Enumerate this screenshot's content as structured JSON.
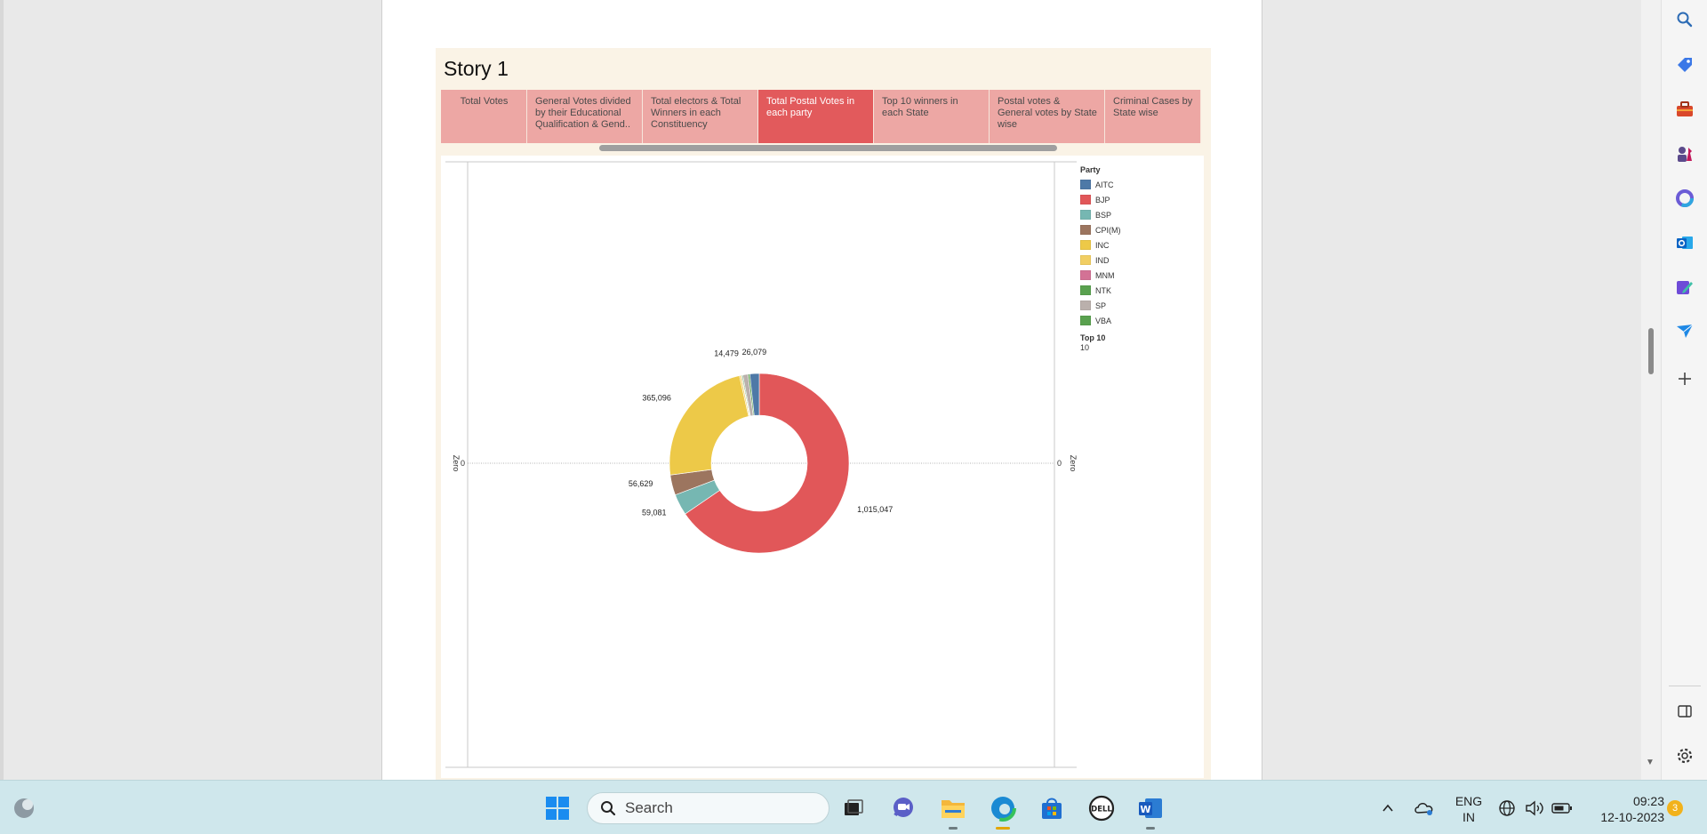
{
  "story": {
    "title": "Story 1",
    "tabs": [
      {
        "label": "Total Votes",
        "width": 97,
        "active": false,
        "centered": true
      },
      {
        "label": "General Votes divided by their Educational Qualification & Gend..",
        "width": 130,
        "active": false
      },
      {
        "label": "Total electors & Total Winners in each Constituency",
        "width": 130,
        "active": false
      },
      {
        "label": "Total Postal Votes in each party",
        "width": 130,
        "active": true
      },
      {
        "label": "Top 10 winners in each State",
        "width": 130,
        "active": false
      },
      {
        "label": "Postal votes & General votes by State wise",
        "width": 130,
        "active": false
      },
      {
        "label": "Criminal Cases by State wise",
        "width": 108,
        "active": false
      }
    ]
  },
  "chart_data": {
    "type": "pie",
    "donut": true,
    "title": "",
    "legend_title": "Party",
    "legend_position": "right",
    "slices": [
      {
        "label": "BJP",
        "value": 1015047,
        "color": "#e15759",
        "data_label": "1,015,047"
      },
      {
        "label": "BSP",
        "value": 59081,
        "color": "#76b7b2",
        "data_label": "59,081"
      },
      {
        "label": "CPI(M)",
        "value": 56629,
        "color": "#9c755f",
        "data_label": "56,629"
      },
      {
        "label": "INC",
        "value": 365096,
        "color": "#edc948",
        "data_label": "365,096"
      },
      {
        "label": "IND",
        "value": 4500,
        "color": "#f1ce63",
        "data_label": ""
      },
      {
        "label": "MNM",
        "value": 2000,
        "color": "#d37295",
        "data_label": ""
      },
      {
        "label": "NTK",
        "value": 3000,
        "color": "#59a14f",
        "data_label": ""
      },
      {
        "label": "SP",
        "value": 14479,
        "color": "#bab0ac",
        "data_label": "14,479"
      },
      {
        "label": "VBA",
        "value": 5000,
        "color": "#59a14f",
        "data_label": ""
      },
      {
        "label": "AITC",
        "value": 26079,
        "color": "#4e79a7",
        "data_label": "26,079"
      }
    ],
    "legend": [
      {
        "label": "AITC",
        "color": "#4e79a7"
      },
      {
        "label": "BJP",
        "color": "#e15759"
      },
      {
        "label": "BSP",
        "color": "#76b7b2"
      },
      {
        "label": "CPI(M)",
        "color": "#9c755f"
      },
      {
        "label": "INC",
        "color": "#edc948"
      },
      {
        "label": "IND",
        "color": "#f1ce63"
      },
      {
        "label": "MNM",
        "color": "#d37295"
      },
      {
        "label": "NTK",
        "color": "#59a14f"
      },
      {
        "label": "SP",
        "color": "#bab0ac"
      },
      {
        "label": "VBA",
        "color": "#59a14f"
      }
    ],
    "filter": {
      "title": "Top 10",
      "value": "10"
    },
    "axis": {
      "left_label": "Zero",
      "right_label": "Zero",
      "left_tick": "0",
      "right_tick": "0"
    }
  },
  "taskbar": {
    "search_placeholder": "Search",
    "language": "ENG",
    "region": "IN",
    "time": "09:23",
    "date": "12-10-2023",
    "notification_count": "3"
  },
  "colors": {
    "tab_inactive": "#eda7a4",
    "tab_active": "#e25a5c",
    "story_background": "#faf3e6",
    "taskbar": "#cfe7ec"
  }
}
